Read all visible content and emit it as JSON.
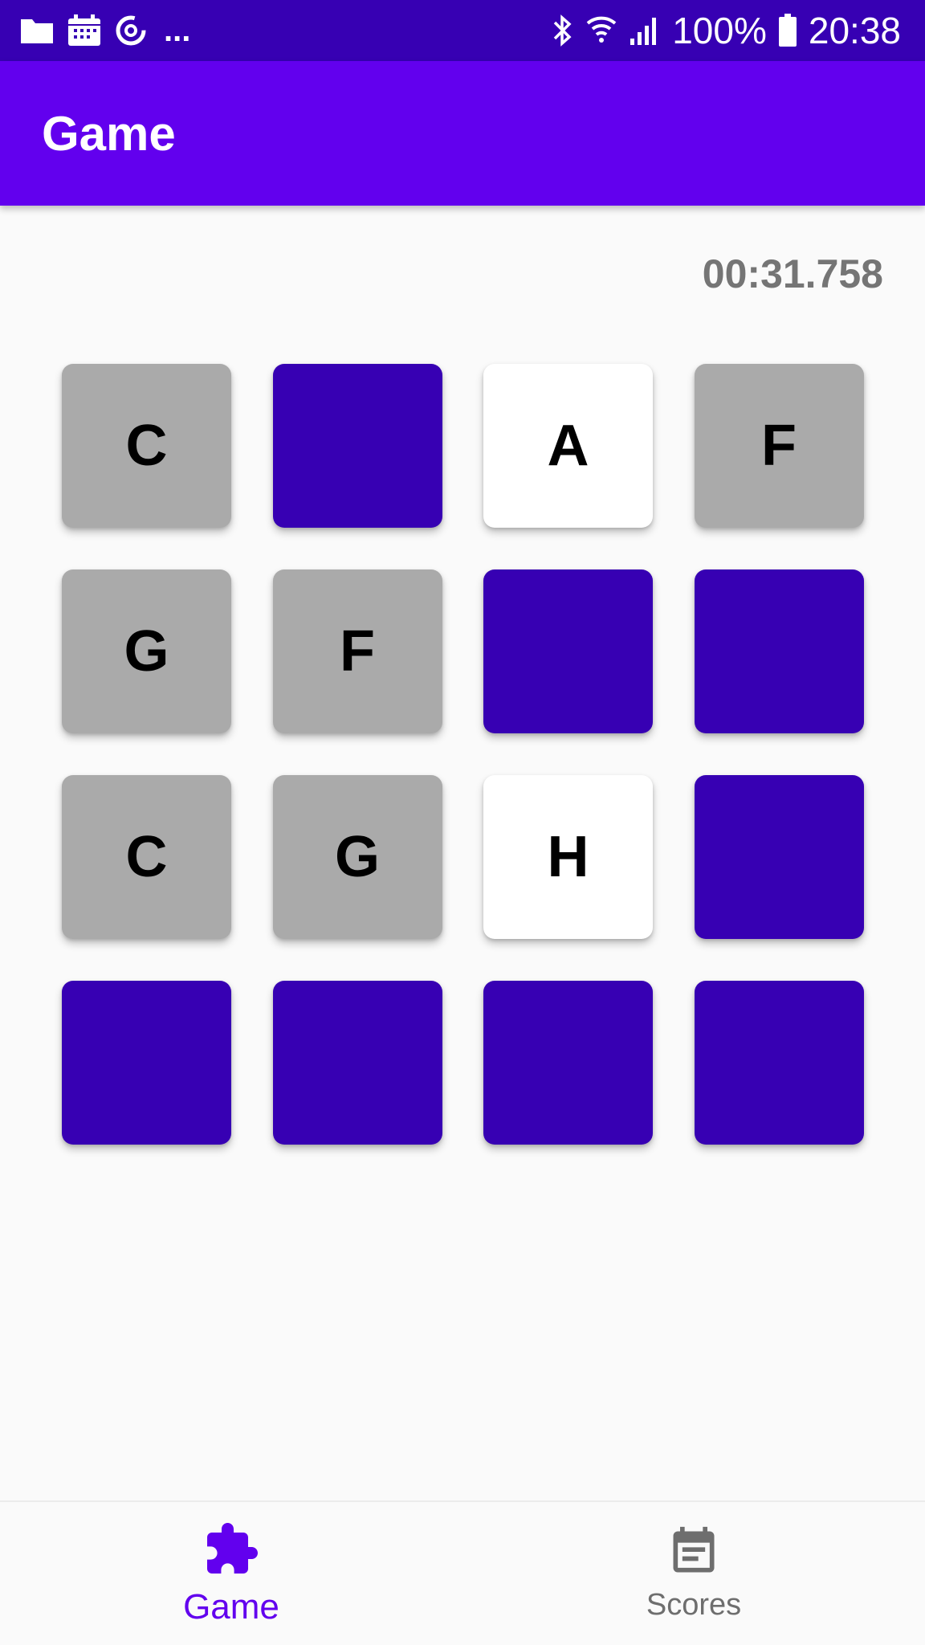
{
  "status_bar": {
    "battery": "100%",
    "time": "20:38",
    "more": "...",
    "icons_left": [
      "folder-icon",
      "calendar-icon",
      "sync-icon"
    ],
    "icons_right": [
      "bluetooth-icon",
      "wifi-icon",
      "signal-icon",
      "battery-icon"
    ]
  },
  "app_bar": {
    "title": "Game"
  },
  "timer": "00:31.758",
  "board": {
    "rows": 4,
    "columns": 4,
    "cards": [
      {
        "letter": "C",
        "state": "matched"
      },
      {
        "letter": "",
        "state": "face-down"
      },
      {
        "letter": "A",
        "state": "revealed"
      },
      {
        "letter": "F",
        "state": "matched"
      },
      {
        "letter": "G",
        "state": "matched"
      },
      {
        "letter": "F",
        "state": "matched"
      },
      {
        "letter": "",
        "state": "face-down"
      },
      {
        "letter": "",
        "state": "face-down"
      },
      {
        "letter": "C",
        "state": "matched"
      },
      {
        "letter": "G",
        "state": "matched"
      },
      {
        "letter": "H",
        "state": "revealed"
      },
      {
        "letter": "",
        "state": "face-down"
      },
      {
        "letter": "",
        "state": "face-down"
      },
      {
        "letter": "",
        "state": "face-down"
      },
      {
        "letter": "",
        "state": "face-down"
      },
      {
        "letter": "",
        "state": "face-down"
      }
    ]
  },
  "bottom_nav": {
    "items": [
      {
        "label": "Game",
        "icon": "puzzle-icon",
        "active": true
      },
      {
        "label": "Scores",
        "icon": "scores-icon",
        "active": false
      }
    ]
  },
  "colors": {
    "status_bar": "#3700b3",
    "app_bar": "#6200ee",
    "card_face_down": "#3700b3",
    "card_matched": "#aaaaaa",
    "card_revealed": "#ffffff",
    "nav_active": "#6200ee",
    "nav_inactive": "#6e6e6e",
    "timer_text": "#757575"
  }
}
